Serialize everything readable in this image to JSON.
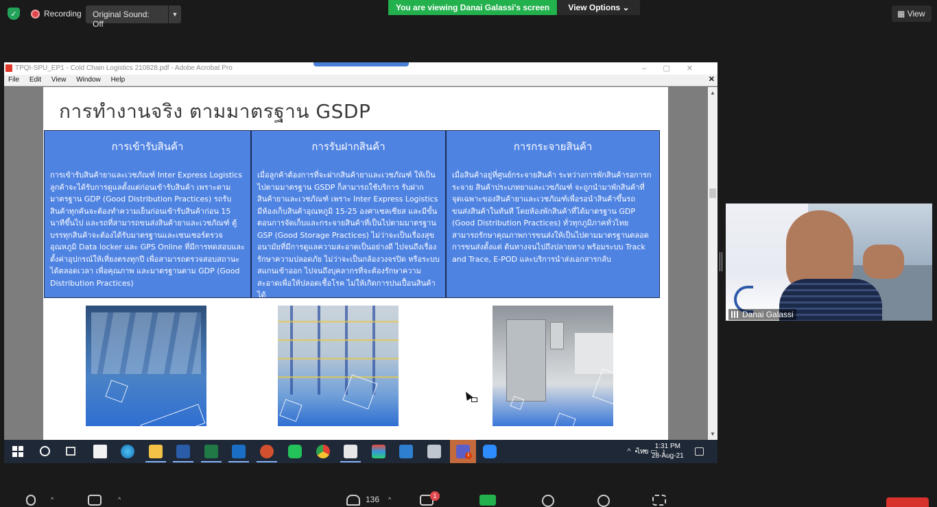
{
  "zoom": {
    "recording_label": "Recording",
    "original_sound": "Original Sound: Off",
    "viewing_banner": "You are viewing Danai Galassi's screen",
    "view_options": "View Options",
    "view_button": "View",
    "participants_count": "136",
    "chat_badge": "1",
    "participant_name": "Danai Galassi",
    "accent": "#23b14d"
  },
  "acrobat": {
    "title": "TPQI-SPU_EP1 - Cold Chain Logistics 210828.pdf - Adobe Acrobat Pro",
    "menu": [
      "File",
      "Edit",
      "View",
      "Window",
      "Help"
    ]
  },
  "slide": {
    "title": "การทำงานจริง ตามมาตรฐาน GSDP",
    "panel_color": "#4f83e2",
    "panels": [
      {
        "heading": "การเข้ารับสินค้า",
        "body": "การเข้ารับสินค้ายาและเวชภัณฑ์ Inter Express Logistics ลูกค้าจะได้รับการดูแลตั้งแต่ก่อนเข้ารับสินค้า เพราะตามมาตรฐาน GDP (Good Distribution Practices) รถรับสินค้าทุกคันจะต้องทำความเย็นก่อนเข้ารับสินค้าก่อน 15 นาทีขึ้นไป และรถที่สามารถขนส่งสินค้ายาและเวชภัณฑ์ ตู้บรรทุกสินค้าจะต้องได้รับมาตรฐานและเซนเซอร์ตรวจอุณหภูมิ Data locker และ GPS Online ที่มีการทดสอบและตั้งค่าอุปกรณ์ให้เที่ยงตรงทุกปี เพื่อสามารถตรวจสอบสถานะได้ตลอดเวลา เพื่อคุณภาพ และมาตรฐานตาม GDP (Good Distribution Practices)"
      },
      {
        "heading": "การรับฝากสินค้า",
        "body": "เมื่อลูกค้าต้องการที่จะฝากสินค้ายาและเวชภัณฑ์ ให้เป็นไปตามมาตรฐาน GSDP ก็สามารถใช้บริการ รับฝากสินค้ายาและเวชภัณฑ์ เพราะ Inter Express Logistics มีห้องเก็บสินค้าอุณหภูมิ 15-25 องศาเซลเซียส และมีขั้นตอนการจัดเก็บและกระจายสินค้าที่เป็นไปตามมาตรฐาน GSP (Good Storage Practices) ไม่ว่าจะเป็นเรื่องสุขอนามัยที่มีการดูแลความสะอาดเป็นอย่างดี ไปจนถึงเรื่องรักษาความปลอดภัย ไม่ว่าจะเป็นกล้องวงจรปิด หรือระบบสแกนเข้าออก ไปจนถึงบุคลากรที่จะต้องรักษาความสะอาดเพื่อให้ปลอดเชื้อโรค ไม่ให้เกิดการปนเปื้อนสินค้าได้"
      },
      {
        "heading": "การกระจายสินค้า",
        "body": "เมื่อสินค้าอยู่ที่ศูนย์กระจายสินค้า ระหว่างการพักสินค้ารอการกระจาย สินค้าประเภทยาและเวชภัณฑ์ จะถูกนำมาพักสินค้าที่จุดเฉพาะของสินค้ายาและเวชภัณฑ์เพื่อรอนำสินค้าขึ้นรถขนส่งสินค้าในทันที โดยห้องพักสินค้าที่ได้มาตรฐาน GDP (Good Distribution Practices) ทั่วทุกภูมิภาคทั่วไทย สามารถรักษาคุณภาพการขนส่งให้เป็นไปตามมาตรฐานตลอดการขนส่งตั้งแต่ ต้นทางจนไปถึงปลายทาง พร้อมระบบ Track and Trace, E-POD และบริการนำส่งเอกสารกลับ"
      }
    ],
    "photos": [
      "delivery-vans-photo",
      "warehouse-racks-photo",
      "cold-room-photo"
    ]
  },
  "taskbar": {
    "time": "1:31 PM",
    "date": "28-Aug-21",
    "language": "ไทย",
    "teams_badge": "1"
  }
}
